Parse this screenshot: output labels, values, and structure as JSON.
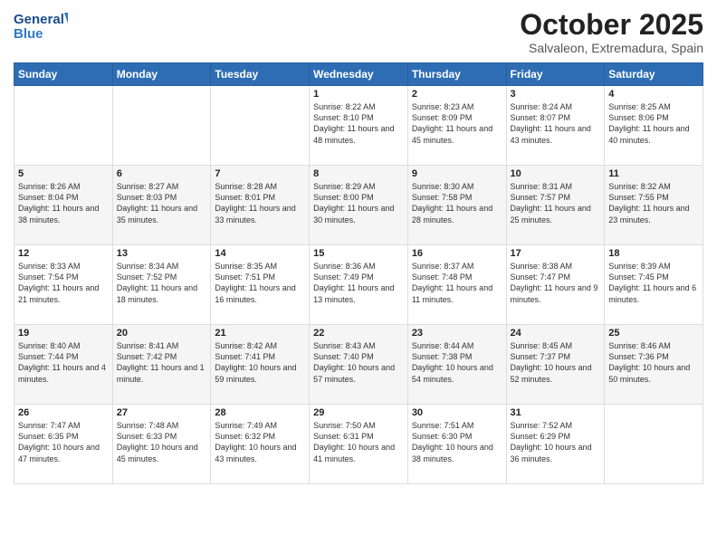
{
  "logo": {
    "general": "General",
    "blue": "Blue"
  },
  "title": "October 2025",
  "subtitle": "Salvaleon, Extremadura, Spain",
  "days_of_week": [
    "Sunday",
    "Monday",
    "Tuesday",
    "Wednesday",
    "Thursday",
    "Friday",
    "Saturday"
  ],
  "weeks": [
    [
      {
        "day": "",
        "info": ""
      },
      {
        "day": "",
        "info": ""
      },
      {
        "day": "",
        "info": ""
      },
      {
        "day": "1",
        "info": "Sunrise: 8:22 AM\nSunset: 8:10 PM\nDaylight: 11 hours and 48 minutes."
      },
      {
        "day": "2",
        "info": "Sunrise: 8:23 AM\nSunset: 8:09 PM\nDaylight: 11 hours and 45 minutes."
      },
      {
        "day": "3",
        "info": "Sunrise: 8:24 AM\nSunset: 8:07 PM\nDaylight: 11 hours and 43 minutes."
      },
      {
        "day": "4",
        "info": "Sunrise: 8:25 AM\nSunset: 8:06 PM\nDaylight: 11 hours and 40 minutes."
      }
    ],
    [
      {
        "day": "5",
        "info": "Sunrise: 8:26 AM\nSunset: 8:04 PM\nDaylight: 11 hours and 38 minutes."
      },
      {
        "day": "6",
        "info": "Sunrise: 8:27 AM\nSunset: 8:03 PM\nDaylight: 11 hours and 35 minutes."
      },
      {
        "day": "7",
        "info": "Sunrise: 8:28 AM\nSunset: 8:01 PM\nDaylight: 11 hours and 33 minutes."
      },
      {
        "day": "8",
        "info": "Sunrise: 8:29 AM\nSunset: 8:00 PM\nDaylight: 11 hours and 30 minutes."
      },
      {
        "day": "9",
        "info": "Sunrise: 8:30 AM\nSunset: 7:58 PM\nDaylight: 11 hours and 28 minutes."
      },
      {
        "day": "10",
        "info": "Sunrise: 8:31 AM\nSunset: 7:57 PM\nDaylight: 11 hours and 25 minutes."
      },
      {
        "day": "11",
        "info": "Sunrise: 8:32 AM\nSunset: 7:55 PM\nDaylight: 11 hours and 23 minutes."
      }
    ],
    [
      {
        "day": "12",
        "info": "Sunrise: 8:33 AM\nSunset: 7:54 PM\nDaylight: 11 hours and 21 minutes."
      },
      {
        "day": "13",
        "info": "Sunrise: 8:34 AM\nSunset: 7:52 PM\nDaylight: 11 hours and 18 minutes."
      },
      {
        "day": "14",
        "info": "Sunrise: 8:35 AM\nSunset: 7:51 PM\nDaylight: 11 hours and 16 minutes."
      },
      {
        "day": "15",
        "info": "Sunrise: 8:36 AM\nSunset: 7:49 PM\nDaylight: 11 hours and 13 minutes."
      },
      {
        "day": "16",
        "info": "Sunrise: 8:37 AM\nSunset: 7:48 PM\nDaylight: 11 hours and 11 minutes."
      },
      {
        "day": "17",
        "info": "Sunrise: 8:38 AM\nSunset: 7:47 PM\nDaylight: 11 hours and 9 minutes."
      },
      {
        "day": "18",
        "info": "Sunrise: 8:39 AM\nSunset: 7:45 PM\nDaylight: 11 hours and 6 minutes."
      }
    ],
    [
      {
        "day": "19",
        "info": "Sunrise: 8:40 AM\nSunset: 7:44 PM\nDaylight: 11 hours and 4 minutes."
      },
      {
        "day": "20",
        "info": "Sunrise: 8:41 AM\nSunset: 7:42 PM\nDaylight: 11 hours and 1 minute."
      },
      {
        "day": "21",
        "info": "Sunrise: 8:42 AM\nSunset: 7:41 PM\nDaylight: 10 hours and 59 minutes."
      },
      {
        "day": "22",
        "info": "Sunrise: 8:43 AM\nSunset: 7:40 PM\nDaylight: 10 hours and 57 minutes."
      },
      {
        "day": "23",
        "info": "Sunrise: 8:44 AM\nSunset: 7:38 PM\nDaylight: 10 hours and 54 minutes."
      },
      {
        "day": "24",
        "info": "Sunrise: 8:45 AM\nSunset: 7:37 PM\nDaylight: 10 hours and 52 minutes."
      },
      {
        "day": "25",
        "info": "Sunrise: 8:46 AM\nSunset: 7:36 PM\nDaylight: 10 hours and 50 minutes."
      }
    ],
    [
      {
        "day": "26",
        "info": "Sunrise: 7:47 AM\nSunset: 6:35 PM\nDaylight: 10 hours and 47 minutes."
      },
      {
        "day": "27",
        "info": "Sunrise: 7:48 AM\nSunset: 6:33 PM\nDaylight: 10 hours and 45 minutes."
      },
      {
        "day": "28",
        "info": "Sunrise: 7:49 AM\nSunset: 6:32 PM\nDaylight: 10 hours and 43 minutes."
      },
      {
        "day": "29",
        "info": "Sunrise: 7:50 AM\nSunset: 6:31 PM\nDaylight: 10 hours and 41 minutes."
      },
      {
        "day": "30",
        "info": "Sunrise: 7:51 AM\nSunset: 6:30 PM\nDaylight: 10 hours and 38 minutes."
      },
      {
        "day": "31",
        "info": "Sunrise: 7:52 AM\nSunset: 6:29 PM\nDaylight: 10 hours and 36 minutes."
      },
      {
        "day": "",
        "info": ""
      }
    ]
  ]
}
